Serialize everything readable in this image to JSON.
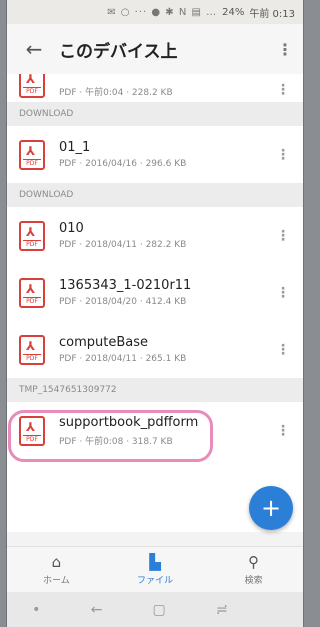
{
  "status_bar": {
    "icons": "✉ ○ ···  ● ✱ N ▤ …",
    "battery": "24%",
    "time": "午前 0:13"
  },
  "app_bar": {
    "back_icon": "arrow-left",
    "title": "このデバイス上",
    "menu_icon": "more-vert"
  },
  "sections": [
    {
      "header": "",
      "files": [
        {
          "name": "",
          "meta": "PDF · 午前0:04 · 228.2 KB"
        }
      ]
    },
    {
      "header": "DOWNLOAD",
      "files": [
        {
          "name": "01_1",
          "meta": "PDF · 2016/04/16 · 296.6 KB"
        }
      ]
    },
    {
      "header": "DOWNLOAD",
      "files": [
        {
          "name": "010",
          "meta": "PDF · 2018/04/11 · 282.2 KB"
        },
        {
          "name": "1365343_1-0210r11",
          "meta": "PDF · 2018/04/20 · 412.4 KB"
        },
        {
          "name": "computeBase",
          "meta": "PDF · 2018/04/11 · 265.1 KB"
        }
      ]
    },
    {
      "header": "TMP_1547651309772",
      "files": [
        {
          "name": "supportbook_pdfform",
          "meta": "PDF · 午前0:08 · 318.7 KB"
        }
      ]
    }
  ],
  "pdf_badge": "PDF",
  "fab": {
    "icon": "plus",
    "label": "+"
  },
  "bottom_nav": [
    {
      "label": "ホーム",
      "icon": "home-icon",
      "active": false
    },
    {
      "label": "ファイル",
      "icon": "file-icon",
      "active": true
    },
    {
      "label": "検索",
      "icon": "search-icon",
      "active": false
    }
  ],
  "colors": {
    "accent": "#2b7fd6",
    "pdf_red": "#d9403a",
    "highlight": "#e98bbb"
  }
}
